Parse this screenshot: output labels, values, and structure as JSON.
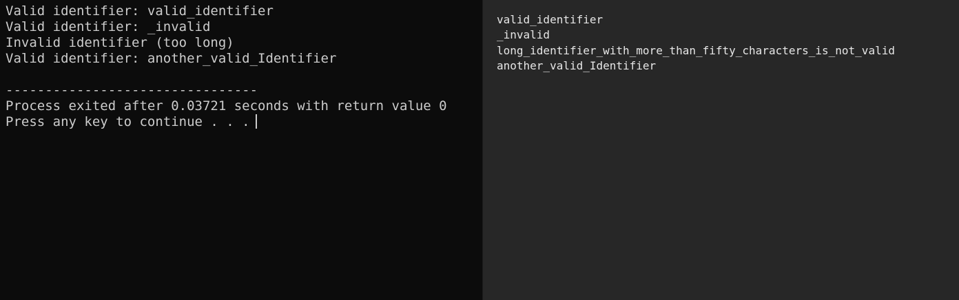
{
  "console": {
    "lines": [
      "Valid identifier: valid_identifier",
      "Valid identifier: _invalid",
      "Invalid identifier (too long)",
      "Valid identifier: another_valid_Identifier"
    ],
    "separator": "--------------------------------",
    "exit_message": "Process exited after 0.03721 seconds with return value 0",
    "prompt": "Press any key to continue . . ."
  },
  "input_file": {
    "lines": [
      "valid_identifier",
      "_invalid",
      "long_identifier_with_more_than_fifty_characters_is_not_valid",
      "another_valid_Identifier"
    ]
  },
  "colors": {
    "console_bg": "#0c0c0c",
    "console_text": "#cccccc",
    "pane_bg": "#272727",
    "pane_text": "#e6e6e6"
  }
}
